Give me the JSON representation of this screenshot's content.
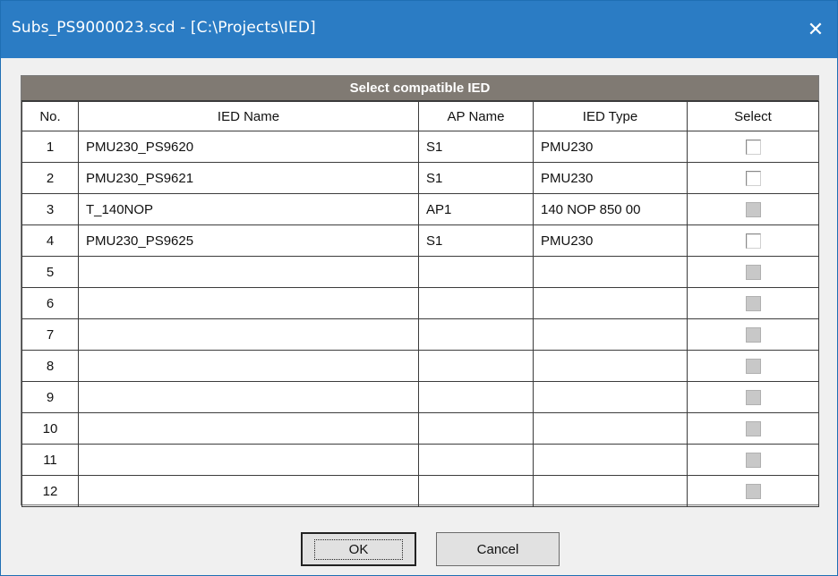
{
  "window": {
    "title": "Subs_PS9000023.scd - [C:\\Projects\\IED]",
    "close_glyph": "✕"
  },
  "table": {
    "caption": "Select compatible IED",
    "headers": [
      "No.",
      "IED Name",
      "AP Name",
      "IED Type",
      "Select"
    ],
    "rows": [
      {
        "no": "1",
        "ied_name": "PMU230_PS9620",
        "ap_name": "S1",
        "ied_type": "PMU230",
        "select_enabled": true,
        "checked": false
      },
      {
        "no": "2",
        "ied_name": "PMU230_PS9621",
        "ap_name": "S1",
        "ied_type": "PMU230",
        "select_enabled": true,
        "checked": false
      },
      {
        "no": "3",
        "ied_name": "T_140NOP",
        "ap_name": "AP1",
        "ied_type": "140 NOP 850 00",
        "select_enabled": false,
        "checked": false
      },
      {
        "no": "4",
        "ied_name": "PMU230_PS9625",
        "ap_name": "S1",
        "ied_type": "PMU230",
        "select_enabled": true,
        "checked": false
      },
      {
        "no": "5",
        "ied_name": "",
        "ap_name": "",
        "ied_type": "",
        "select_enabled": false,
        "checked": false
      },
      {
        "no": "6",
        "ied_name": "",
        "ap_name": "",
        "ied_type": "",
        "select_enabled": false,
        "checked": false
      },
      {
        "no": "7",
        "ied_name": "",
        "ap_name": "",
        "ied_type": "",
        "select_enabled": false,
        "checked": false
      },
      {
        "no": "8",
        "ied_name": "",
        "ap_name": "",
        "ied_type": "",
        "select_enabled": false,
        "checked": false
      },
      {
        "no": "9",
        "ied_name": "",
        "ap_name": "",
        "ied_type": "",
        "select_enabled": false,
        "checked": false
      },
      {
        "no": "10",
        "ied_name": "",
        "ap_name": "",
        "ied_type": "",
        "select_enabled": false,
        "checked": false
      },
      {
        "no": "11",
        "ied_name": "",
        "ap_name": "",
        "ied_type": "",
        "select_enabled": false,
        "checked": false
      },
      {
        "no": "12",
        "ied_name": "",
        "ap_name": "",
        "ied_type": "",
        "select_enabled": false,
        "checked": false
      }
    ]
  },
  "buttons": {
    "ok": "OK",
    "cancel": "Cancel"
  },
  "colors": {
    "titlebar": "#2b7cc4",
    "caption_bg": "#807a73",
    "dialog_bg": "#f0f0f0"
  }
}
